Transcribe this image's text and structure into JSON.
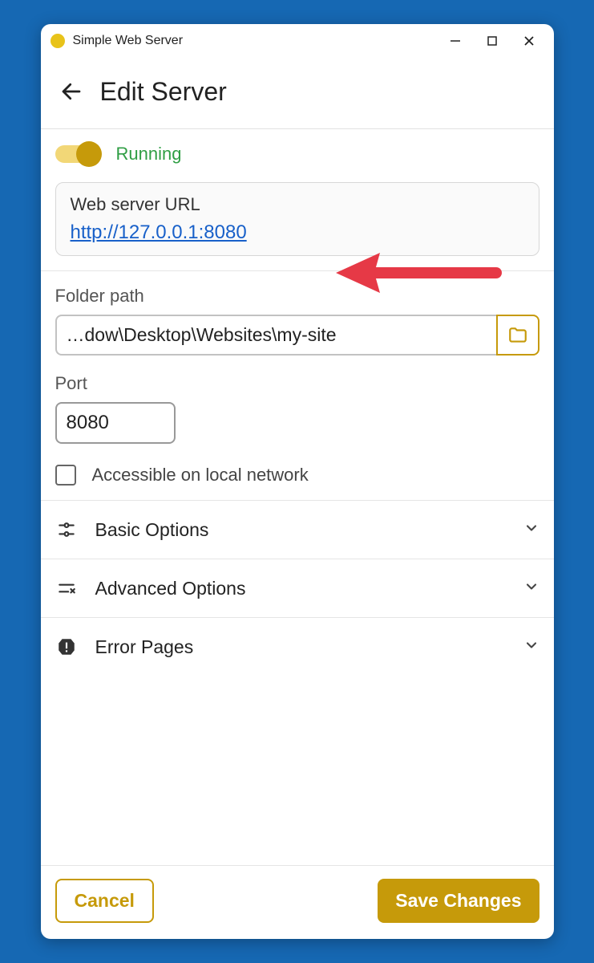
{
  "window": {
    "title": "Simple Web Server"
  },
  "header": {
    "title": "Edit Server"
  },
  "status": {
    "label": "Running",
    "running": true
  },
  "url_card": {
    "label": "Web server URL",
    "url": "http://127.0.0.1:8080"
  },
  "folder": {
    "label": "Folder path",
    "value": "…dow\\Desktop\\Websites\\my-site"
  },
  "port": {
    "label": "Port",
    "value": "8080"
  },
  "local_network": {
    "label": "Accessible on local network",
    "checked": false
  },
  "sections": {
    "basic": "Basic Options",
    "advanced": "Advanced Options",
    "error_pages": "Error Pages"
  },
  "footer": {
    "cancel": "Cancel",
    "save": "Save Changes"
  },
  "colors": {
    "accent": "#c69a0a",
    "running": "#2f9e44",
    "link": "#1860c9",
    "annotation_arrow": "#e63946"
  }
}
